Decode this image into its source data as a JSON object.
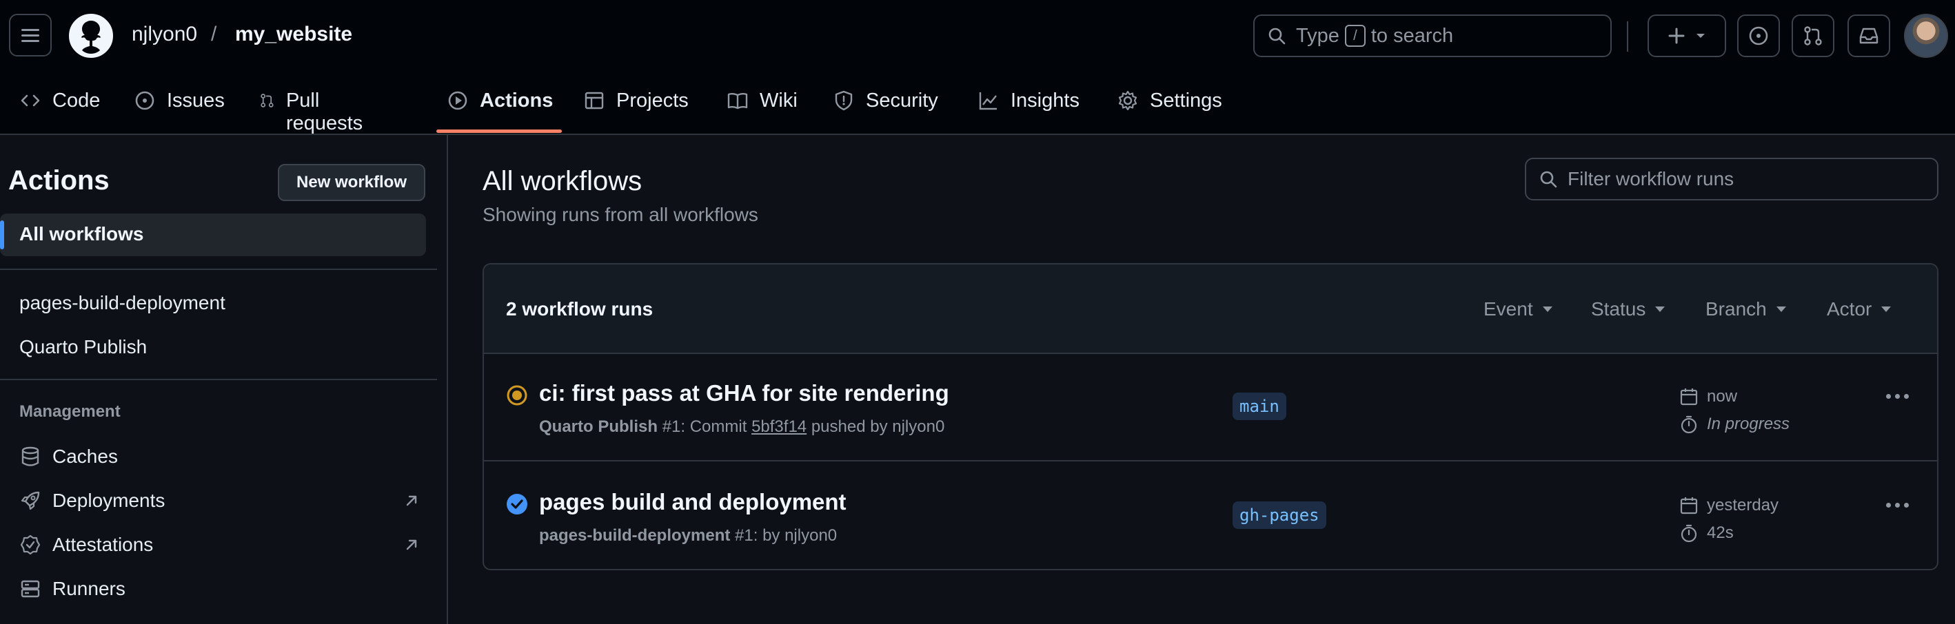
{
  "header": {
    "repo_owner": "njlyon0",
    "repo_separator": "/",
    "repo_name": "my_website",
    "search_prefix": "Type",
    "search_key": "/",
    "search_suffix": "to search"
  },
  "nav": {
    "tabs": [
      {
        "label": "Code",
        "icon": "code-icon"
      },
      {
        "label": "Issues",
        "icon": "issue-icon"
      },
      {
        "label": "Pull requests",
        "icon": "pull-request-icon"
      },
      {
        "label": "Actions",
        "icon": "play-icon",
        "active": true
      },
      {
        "label": "Projects",
        "icon": "table-icon"
      },
      {
        "label": "Wiki",
        "icon": "book-icon"
      },
      {
        "label": "Security",
        "icon": "shield-icon"
      },
      {
        "label": "Insights",
        "icon": "graph-icon"
      },
      {
        "label": "Settings",
        "icon": "gear-icon"
      }
    ]
  },
  "sidebar": {
    "title": "Actions",
    "new_workflow_label": "New workflow",
    "active_item": "All workflows",
    "workflows": [
      "pages-build-deployment",
      "Quarto Publish"
    ],
    "management_heading": "Management",
    "management_items": [
      {
        "label": "Caches",
        "icon": "database-icon"
      },
      {
        "label": "Deployments",
        "icon": "rocket-icon",
        "external": true
      },
      {
        "label": "Attestations",
        "icon": "verified-icon",
        "external": true
      },
      {
        "label": "Runners",
        "icon": "server-icon"
      }
    ]
  },
  "main": {
    "title": "All workflows",
    "subtitle": "Showing runs from all workflows",
    "filter_placeholder": "Filter workflow runs",
    "runs_count": "2 workflow runs",
    "filters": [
      "Event",
      "Status",
      "Branch",
      "Actor"
    ],
    "runs": [
      {
        "status": "in-progress",
        "title": "ci: first pass at GHA for site rendering",
        "workflow": "Quarto Publish",
        "run_number": "#1",
        "meta_mid": ": Commit",
        "commit": "5bf3f14",
        "meta_end": "pushed by njlyon0",
        "branch": "main",
        "when": "now",
        "duration": "In progress"
      },
      {
        "status": "success",
        "title": "pages build and deployment",
        "workflow": "pages-build-deployment",
        "run_number": "#1",
        "meta_mid": ": by njlyon0",
        "commit": "",
        "meta_end": "",
        "branch": "gh-pages",
        "when": "yesterday",
        "duration": "42s"
      }
    ]
  },
  "colors": {
    "background": "#0d1117",
    "header_bg": "#010409",
    "accent_underline": "#f78166",
    "in_progress": "#d29922",
    "success": "#4493f8",
    "branch_text": "#79c0ff"
  }
}
